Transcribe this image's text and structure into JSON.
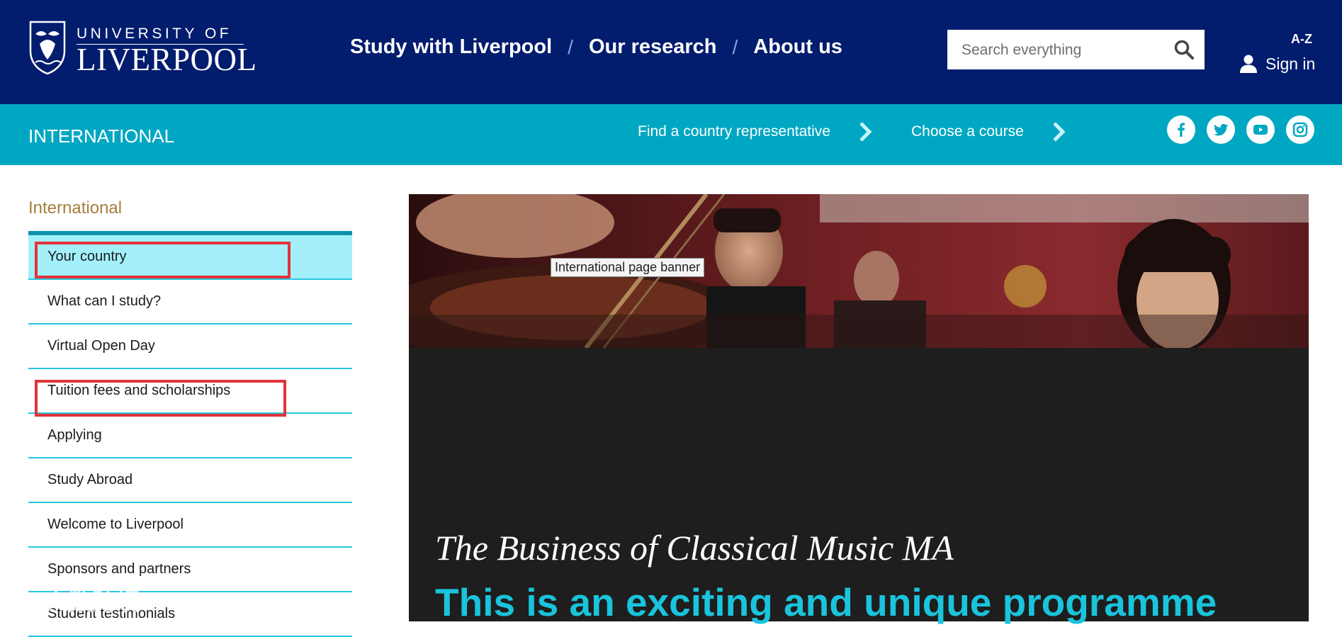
{
  "header": {
    "logo_line1": "UNIVERSITY OF",
    "logo_line2": "LIVERPOOL",
    "nav": [
      {
        "label": "Study with Liverpool"
      },
      {
        "label": "Our research"
      },
      {
        "label": "About us"
      }
    ],
    "nav_separator": "/",
    "search_placeholder": "Search everything",
    "az_label": "A-Z",
    "signin_label": "Sign in"
  },
  "subbar": {
    "section_title": "INTERNATIONAL",
    "links": [
      {
        "label": "Find a country representative"
      },
      {
        "label": "Choose a course"
      }
    ],
    "social": [
      "facebook-icon",
      "twitter-icon",
      "youtube-icon",
      "instagram-icon"
    ]
  },
  "sidebar": {
    "title": "International",
    "items": [
      {
        "label": "Your country",
        "active": true,
        "highlighted": true
      },
      {
        "label": "What can I study?"
      },
      {
        "label": "Virtual Open Day"
      },
      {
        "label": "Tuition fees and scholarships",
        "highlighted": true
      },
      {
        "label": "Applying"
      },
      {
        "label": "Study Abroad"
      },
      {
        "label": "Welcome to Liverpool"
      },
      {
        "label": "Sponsors and partners"
      },
      {
        "label": "Student testimonials"
      }
    ]
  },
  "main": {
    "banner_tooltip": "International page banner",
    "course_title": "The Business of Classical Music MA",
    "course_subtitle": "This is an exciting and unique programme"
  },
  "watermark": "大数跨境",
  "colors": {
    "header_bg": "#021c6e",
    "subbar_bg": "#00a7c2",
    "sidebar_active_bg": "#a3f0fb",
    "sidebar_divider": "#27c7e0",
    "highlight_box": "#e3343a",
    "accent_text": "#19c4dc",
    "sidebar_title": "#a67f3e"
  }
}
